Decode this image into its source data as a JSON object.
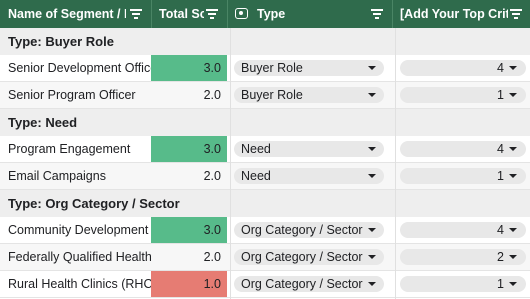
{
  "header": {
    "col_name": "Name of Segment / Ne",
    "col_score": "Total Sc",
    "col_type": "Type",
    "col_criteria": "[Add Your Top Criter"
  },
  "colors": {
    "header_bg": "#2f6b4c",
    "score_high": "#57bb8a",
    "score_low": "#e67c73"
  },
  "sections": [
    {
      "title": "Type: Buyer Role",
      "rows": [
        {
          "name": "Senior Development Officer",
          "score": "3.0",
          "score_color": "green",
          "type": "Buyer Role",
          "criteria": "4"
        },
        {
          "name": "Senior Program Officer",
          "score": "2.0",
          "score_color": "none",
          "type": "Buyer Role",
          "criteria": "1"
        }
      ]
    },
    {
      "title": "Type: Need",
      "rows": [
        {
          "name": "Program Engagement",
          "score": "3.0",
          "score_color": "green",
          "type": "Need",
          "criteria": "4"
        },
        {
          "name": "Email Campaigns",
          "score": "2.0",
          "score_color": "none",
          "type": "Need",
          "criteria": "1"
        }
      ]
    },
    {
      "title": "Type: Org Category / Sector",
      "rows": [
        {
          "name": "Community Development Corporations",
          "score": "3.0",
          "score_color": "green",
          "type": "Org Category / Sector",
          "criteria": "4"
        },
        {
          "name": "Federally Qualified Health Centers",
          "score": "2.0",
          "score_color": "none",
          "type": "Org Category / Sector",
          "criteria": "2"
        },
        {
          "name": "Rural Health Clinics (RHC)",
          "score": "1.0",
          "score_color": "red",
          "type": "Org Category / Sector",
          "criteria": "1"
        }
      ]
    }
  ]
}
